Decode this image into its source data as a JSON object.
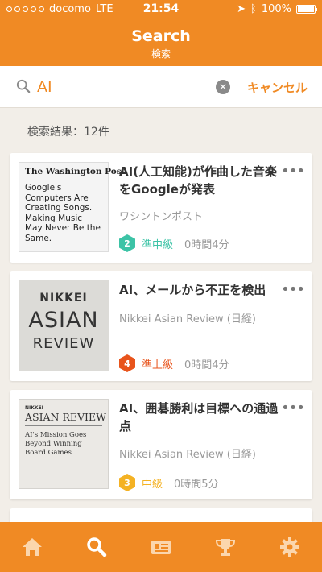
{
  "status": {
    "carrier": "docomo",
    "network": "LTE",
    "time": "21:54",
    "battery": "100%"
  },
  "header": {
    "title": "Search",
    "subtitle": "検索"
  },
  "search": {
    "query": "AI",
    "cancel_label": "キャンセル"
  },
  "results_count": "検索結果：12件",
  "results": [
    {
      "title": "AI(人工知能)が作曲した音楽をGoogleが発表",
      "source": "ワシントンポスト",
      "level_num": "2",
      "level_label": "準中級",
      "level_color": "#3cc3a6",
      "duration": "0時間4分",
      "thumb_logo": "The Washington Post",
      "thumb_text": "Google's Computers Are Creating Songs. Making Music May Never Be the Same."
    },
    {
      "title": "AI、メールから不正を検出",
      "source": "Nikkei Asian Review (日経)",
      "level_num": "4",
      "level_label": "準上級",
      "level_color": "#e8541c",
      "duration": "0時間4分",
      "thumb_line1": "NIKKEI",
      "thumb_line2": "ASIAN",
      "thumb_line3": "REVIEW"
    },
    {
      "title": "AI、囲碁勝利は目標への通過点",
      "source": "Nikkei Asian Review (日経)",
      "level_num": "3",
      "level_label": "中級",
      "level_color": "#f4b224",
      "duration": "0時間5分",
      "thumb_small": "NIKKEI",
      "thumb_brand": "ASIAN REVIEW",
      "thumb_text": "AI's Mission Goes Beyond Winning Board Games"
    }
  ],
  "tabs": [
    "home-icon",
    "search-icon",
    "ticket-icon",
    "trophy-icon",
    "gear-icon"
  ],
  "colors": {
    "accent": "#f08a24",
    "background": "#f2eee8"
  }
}
